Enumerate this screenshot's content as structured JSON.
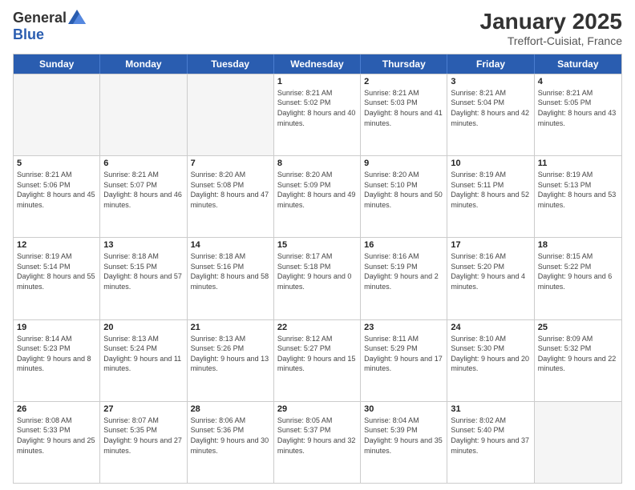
{
  "logo": {
    "general": "General",
    "blue": "Blue"
  },
  "title": "January 2025",
  "subtitle": "Treffort-Cuisiat, France",
  "headers": [
    "Sunday",
    "Monday",
    "Tuesday",
    "Wednesday",
    "Thursday",
    "Friday",
    "Saturday"
  ],
  "weeks": [
    [
      {
        "day": "",
        "sunrise": "",
        "sunset": "",
        "daylight": "",
        "empty": true
      },
      {
        "day": "",
        "sunrise": "",
        "sunset": "",
        "daylight": "",
        "empty": true
      },
      {
        "day": "",
        "sunrise": "",
        "sunset": "",
        "daylight": "",
        "empty": true
      },
      {
        "day": "1",
        "sunrise": "Sunrise: 8:21 AM",
        "sunset": "Sunset: 5:02 PM",
        "daylight": "Daylight: 8 hours and 40 minutes."
      },
      {
        "day": "2",
        "sunrise": "Sunrise: 8:21 AM",
        "sunset": "Sunset: 5:03 PM",
        "daylight": "Daylight: 8 hours and 41 minutes."
      },
      {
        "day": "3",
        "sunrise": "Sunrise: 8:21 AM",
        "sunset": "Sunset: 5:04 PM",
        "daylight": "Daylight: 8 hours and 42 minutes."
      },
      {
        "day": "4",
        "sunrise": "Sunrise: 8:21 AM",
        "sunset": "Sunset: 5:05 PM",
        "daylight": "Daylight: 8 hours and 43 minutes."
      }
    ],
    [
      {
        "day": "5",
        "sunrise": "Sunrise: 8:21 AM",
        "sunset": "Sunset: 5:06 PM",
        "daylight": "Daylight: 8 hours and 45 minutes."
      },
      {
        "day": "6",
        "sunrise": "Sunrise: 8:21 AM",
        "sunset": "Sunset: 5:07 PM",
        "daylight": "Daylight: 8 hours and 46 minutes."
      },
      {
        "day": "7",
        "sunrise": "Sunrise: 8:20 AM",
        "sunset": "Sunset: 5:08 PM",
        "daylight": "Daylight: 8 hours and 47 minutes."
      },
      {
        "day": "8",
        "sunrise": "Sunrise: 8:20 AM",
        "sunset": "Sunset: 5:09 PM",
        "daylight": "Daylight: 8 hours and 49 minutes."
      },
      {
        "day": "9",
        "sunrise": "Sunrise: 8:20 AM",
        "sunset": "Sunset: 5:10 PM",
        "daylight": "Daylight: 8 hours and 50 minutes."
      },
      {
        "day": "10",
        "sunrise": "Sunrise: 8:19 AM",
        "sunset": "Sunset: 5:11 PM",
        "daylight": "Daylight: 8 hours and 52 minutes."
      },
      {
        "day": "11",
        "sunrise": "Sunrise: 8:19 AM",
        "sunset": "Sunset: 5:13 PM",
        "daylight": "Daylight: 8 hours and 53 minutes."
      }
    ],
    [
      {
        "day": "12",
        "sunrise": "Sunrise: 8:19 AM",
        "sunset": "Sunset: 5:14 PM",
        "daylight": "Daylight: 8 hours and 55 minutes."
      },
      {
        "day": "13",
        "sunrise": "Sunrise: 8:18 AM",
        "sunset": "Sunset: 5:15 PM",
        "daylight": "Daylight: 8 hours and 57 minutes."
      },
      {
        "day": "14",
        "sunrise": "Sunrise: 8:18 AM",
        "sunset": "Sunset: 5:16 PM",
        "daylight": "Daylight: 8 hours and 58 minutes."
      },
      {
        "day": "15",
        "sunrise": "Sunrise: 8:17 AM",
        "sunset": "Sunset: 5:18 PM",
        "daylight": "Daylight: 9 hours and 0 minutes."
      },
      {
        "day": "16",
        "sunrise": "Sunrise: 8:16 AM",
        "sunset": "Sunset: 5:19 PM",
        "daylight": "Daylight: 9 hours and 2 minutes."
      },
      {
        "day": "17",
        "sunrise": "Sunrise: 8:16 AM",
        "sunset": "Sunset: 5:20 PM",
        "daylight": "Daylight: 9 hours and 4 minutes."
      },
      {
        "day": "18",
        "sunrise": "Sunrise: 8:15 AM",
        "sunset": "Sunset: 5:22 PM",
        "daylight": "Daylight: 9 hours and 6 minutes."
      }
    ],
    [
      {
        "day": "19",
        "sunrise": "Sunrise: 8:14 AM",
        "sunset": "Sunset: 5:23 PM",
        "daylight": "Daylight: 9 hours and 8 minutes."
      },
      {
        "day": "20",
        "sunrise": "Sunrise: 8:13 AM",
        "sunset": "Sunset: 5:24 PM",
        "daylight": "Daylight: 9 hours and 11 minutes."
      },
      {
        "day": "21",
        "sunrise": "Sunrise: 8:13 AM",
        "sunset": "Sunset: 5:26 PM",
        "daylight": "Daylight: 9 hours and 13 minutes."
      },
      {
        "day": "22",
        "sunrise": "Sunrise: 8:12 AM",
        "sunset": "Sunset: 5:27 PM",
        "daylight": "Daylight: 9 hours and 15 minutes."
      },
      {
        "day": "23",
        "sunrise": "Sunrise: 8:11 AM",
        "sunset": "Sunset: 5:29 PM",
        "daylight": "Daylight: 9 hours and 17 minutes."
      },
      {
        "day": "24",
        "sunrise": "Sunrise: 8:10 AM",
        "sunset": "Sunset: 5:30 PM",
        "daylight": "Daylight: 9 hours and 20 minutes."
      },
      {
        "day": "25",
        "sunrise": "Sunrise: 8:09 AM",
        "sunset": "Sunset: 5:32 PM",
        "daylight": "Daylight: 9 hours and 22 minutes."
      }
    ],
    [
      {
        "day": "26",
        "sunrise": "Sunrise: 8:08 AM",
        "sunset": "Sunset: 5:33 PM",
        "daylight": "Daylight: 9 hours and 25 minutes."
      },
      {
        "day": "27",
        "sunrise": "Sunrise: 8:07 AM",
        "sunset": "Sunset: 5:35 PM",
        "daylight": "Daylight: 9 hours and 27 minutes."
      },
      {
        "day": "28",
        "sunrise": "Sunrise: 8:06 AM",
        "sunset": "Sunset: 5:36 PM",
        "daylight": "Daylight: 9 hours and 30 minutes."
      },
      {
        "day": "29",
        "sunrise": "Sunrise: 8:05 AM",
        "sunset": "Sunset: 5:37 PM",
        "daylight": "Daylight: 9 hours and 32 minutes."
      },
      {
        "day": "30",
        "sunrise": "Sunrise: 8:04 AM",
        "sunset": "Sunset: 5:39 PM",
        "daylight": "Daylight: 9 hours and 35 minutes."
      },
      {
        "day": "31",
        "sunrise": "Sunrise: 8:02 AM",
        "sunset": "Sunset: 5:40 PM",
        "daylight": "Daylight: 9 hours and 37 minutes."
      },
      {
        "day": "",
        "sunrise": "",
        "sunset": "",
        "daylight": "",
        "empty": true
      }
    ]
  ]
}
